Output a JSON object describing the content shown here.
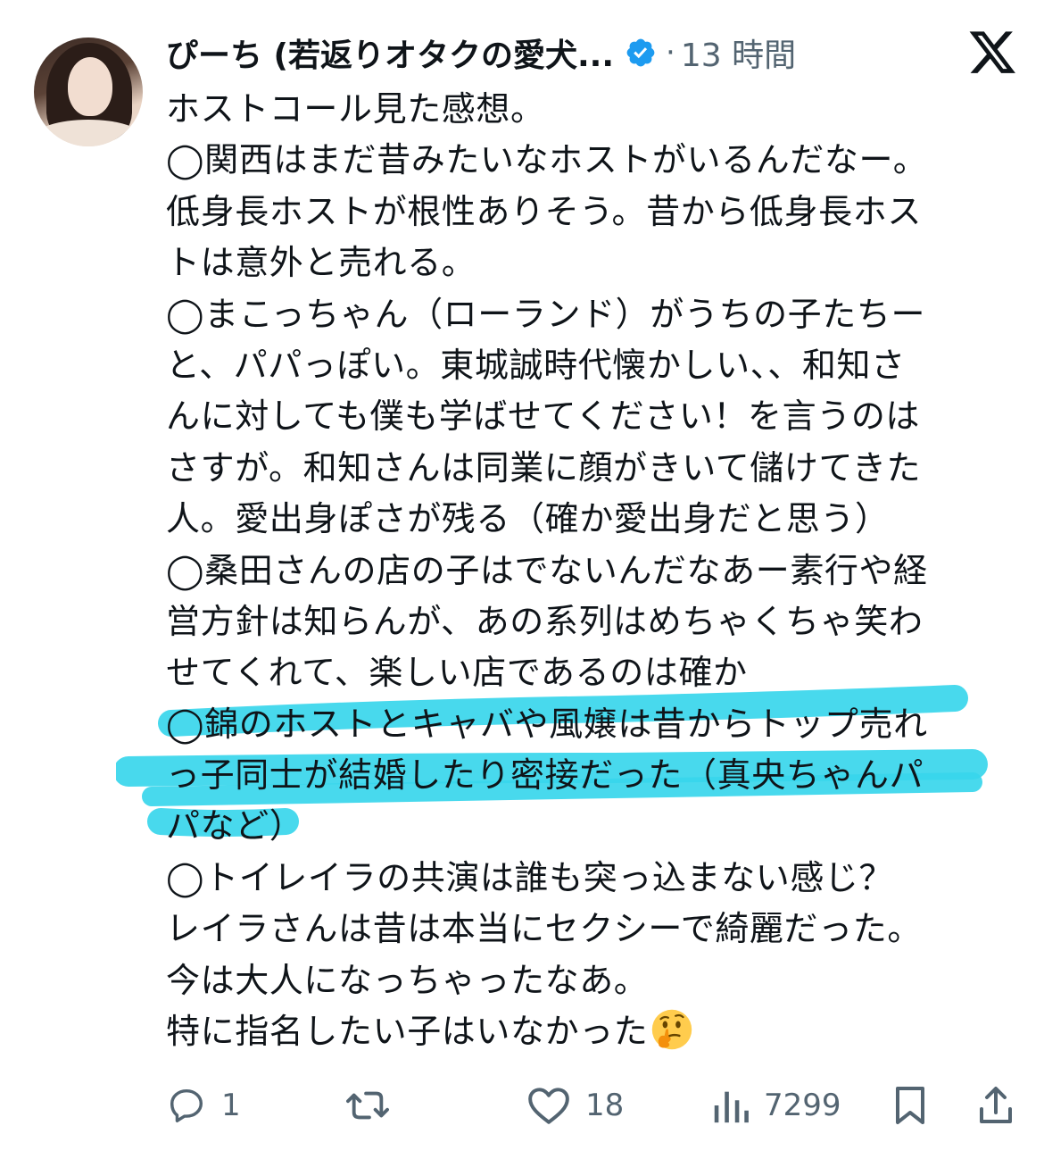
{
  "post": {
    "author_name": "ぴーち (若返りオタクの愛犬...",
    "time_separator": "·",
    "time_ago": "13 時間",
    "body_lines": [
      "ホストコール見た感想。",
      "◯関西はまだ昔みたいなホストがいるんだなー。",
      "低身長ホストが根性ありそう。昔から低身長ホス",
      "トは意外と売れる。",
      "◯まこっちゃん（ローランド）がうちの子たちー",
      "と、パパっぽい。東城誠時代懐かしい、、和知さ",
      "んに対しても僕も学ばせてください！を言うのは",
      "さすが。和知さんは同業に顔がきいて儲けてきた",
      "人。愛出身ぽさが残る（確か愛出身だと思う）",
      "◯桑田さんの店の子はでないんだなあー素行や経",
      "営方針は知らんが、あの系列はめちゃくちゃ笑わ",
      "せてくれて、楽しい店であるのは確か",
      "◯錦のホストとキャバや風嬢は昔からトップ売れ",
      "っ子同士が結婚したり密接だった（真央ちゃんパ",
      "パなど）",
      "◯トイレイラの共演は誰も突っ込まない感じ？",
      "レイラさんは昔は本当にセクシーで綺麗だった。",
      "今は大人になっちゃったなあ。",
      "特に指名したい子はいなかった"
    ],
    "emoji_icon": "thinking-face-emoji",
    "highlight_color": "#38d6ec"
  },
  "actions": {
    "reply_count": "1",
    "repost_count": "",
    "like_count": "18",
    "view_count": "7299"
  },
  "icons": {
    "verified": "verified-badge-icon",
    "x_logo": "x-logo-icon",
    "reply": "reply-icon",
    "repost": "repost-icon",
    "like": "heart-icon",
    "views": "views-chart-icon",
    "bookmark": "bookmark-icon",
    "share": "share-icon"
  },
  "colors": {
    "text": "#0f1419",
    "secondary": "#536471",
    "verified_blue": "#1d9bf0"
  }
}
